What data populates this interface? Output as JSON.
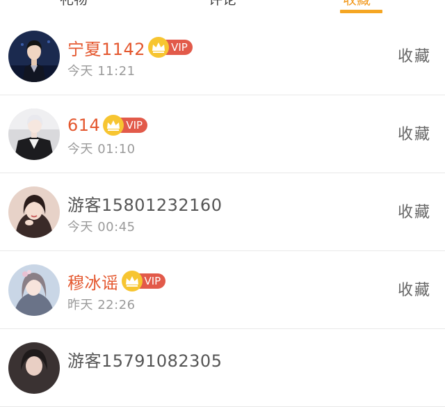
{
  "tabs": [
    {
      "label": "礼物"
    },
    {
      "label": "评论"
    },
    {
      "label": "收藏"
    }
  ],
  "active_tab_color": "#f5a623",
  "vip_badge_label": "VIP",
  "vip_name_color": "#e4572e",
  "rows": [
    {
      "name": "宁夏1142",
      "vip": true,
      "time": "今天 11:21",
      "action": "收藏"
    },
    {
      "name": "614",
      "vip": true,
      "time": "今天 01:10",
      "action": "收藏"
    },
    {
      "name": "游客15801232160",
      "vip": false,
      "time": "今天 00:45",
      "action": "收藏"
    },
    {
      "name": "穆冰谣",
      "vip": true,
      "time": "昨天 22:26",
      "action": "收藏"
    },
    {
      "name": "游客15791082305",
      "vip": false,
      "time": "",
      "action": ""
    }
  ]
}
